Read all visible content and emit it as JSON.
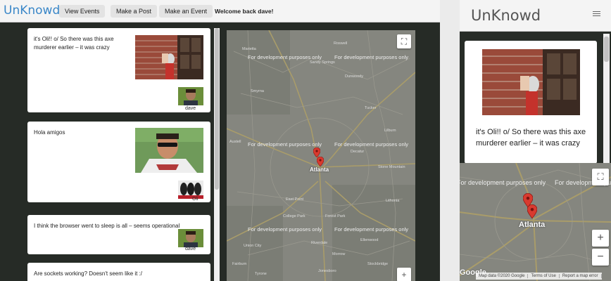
{
  "app": {
    "brand": "UnKnowd"
  },
  "nav": {
    "buttons": [
      "View Events",
      "Make a Post",
      "Make an Event"
    ],
    "welcome": "Welcome back dave!"
  },
  "posts": [
    {
      "text": "it's Oli!! o/  So there was this axe murderer earlier – it was crazy",
      "user": "dave"
    },
    {
      "text": "Hola amigos",
      "user": "Oli"
    },
    {
      "text": "I think the browser went to sleep is all – seems operational",
      "user": "dave"
    },
    {
      "text": "Are sockets working? Doesn't seem like it :/",
      "user": ""
    }
  ],
  "map": {
    "dev_text": "For development purposes only",
    "city": "Atlanta",
    "pin_color": "#d93a2f",
    "labels": [
      "Marietta",
      "Sandy Springs",
      "Roswell",
      "Dunwoody",
      "Smyrna",
      "Decatur",
      "Stone Mountain",
      "East Point",
      "College Park",
      "Forest Park",
      "Tucker",
      "Lithonia",
      "Austell",
      "Lilburn",
      "Union City",
      "Fairburn",
      "Ellenwood",
      "Stockbridge",
      "Riverdale",
      "Morrow",
      "Tyrone",
      "Jonesboro"
    ]
  },
  "mobile": {
    "brand": "UnKnowd",
    "post_text": "it's Oli!! o/  So there was this axe murderer earlier – it was crazy",
    "dev_text": "For development purposes only",
    "city": "Atlanta",
    "footer": [
      "Map data ©2020 Google",
      "Terms of Use",
      "Report a map error"
    ],
    "google": "Google"
  },
  "colors": {
    "brand_blue": "#3a87c8",
    "pin": "#d93a2f",
    "background": "#262b26"
  }
}
